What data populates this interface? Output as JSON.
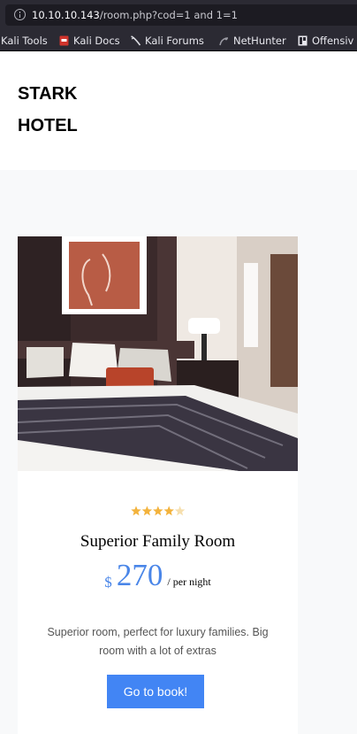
{
  "browser": {
    "url_host": "10.10.10.143",
    "url_rest": "/room.php?cod=1 and 1=1",
    "bookmarks": [
      {
        "label": "Kali Tools",
        "icon": "kali-icon"
      },
      {
        "label": "Kali Docs",
        "icon": "kali-docs-icon"
      },
      {
        "label": "Kali Forums",
        "icon": "kali-forums-icon"
      },
      {
        "label": "NetHunter",
        "icon": "nethunter-icon"
      },
      {
        "label": "Offensiv",
        "icon": "offensive-icon"
      }
    ]
  },
  "header": {
    "brand_line1": "STARK",
    "brand_line2": "HOTEL"
  },
  "room": {
    "rating": 4,
    "rating_max": 5,
    "name": "Superior Family Room",
    "currency": "$",
    "price": "270",
    "per_night": "/ per night",
    "description": "Superior room, perfect for luxury families. Big room with a lot of extras",
    "book_label": "Go to book!"
  },
  "colors": {
    "accent": "#4285f4",
    "price": "#4a86e8",
    "star": "#f3b33d"
  }
}
